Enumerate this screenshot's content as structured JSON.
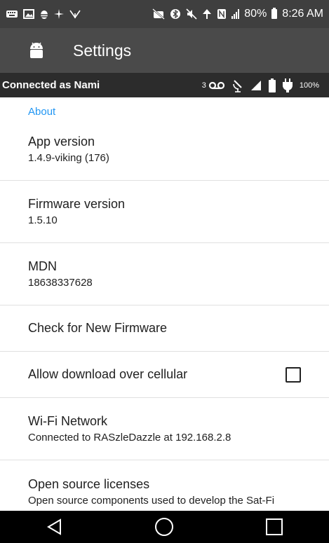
{
  "status_bar": {
    "battery_pct": "80%",
    "time": "8:26 AM",
    "left_icons": [
      "keyboard-icon",
      "image-icon",
      "bug-icon",
      "sparkle-icon",
      "usb-icon"
    ],
    "right_icons": [
      "wifi-off-icon",
      "bluetooth-icon",
      "mute-icon",
      "network-icon",
      "nfc-icon",
      "signal-icon"
    ]
  },
  "app_bar": {
    "title": "Settings",
    "icon": "android-icon"
  },
  "connection_bar": {
    "text": "Connected as Nami",
    "count": "3",
    "battery": "100%"
  },
  "section": {
    "title": "About"
  },
  "items": [
    {
      "title": "App version",
      "subtitle": "1.4.9-viking (176)"
    },
    {
      "title": "Firmware version",
      "subtitle": "1.5.10"
    },
    {
      "title": "MDN",
      "subtitle": "18638337628"
    },
    {
      "title": "Check for New Firmware"
    },
    {
      "title": "Allow download over cellular",
      "checked": false
    },
    {
      "title": "Wi-Fi Network",
      "subtitle": "Connected to RASzleDazzle at 192.168.2.8"
    },
    {
      "title": "Open source licenses",
      "subtitle": "Open source components used to develop the Sat-Fi"
    }
  ],
  "nav": {
    "buttons": [
      "back-icon",
      "home-icon",
      "recents-icon"
    ]
  },
  "colors": {
    "accent": "#2196f3",
    "app_bar": "#4a4a4a",
    "status_bar": "#3f3f3f",
    "connection_bar": "#2c2c2c"
  }
}
